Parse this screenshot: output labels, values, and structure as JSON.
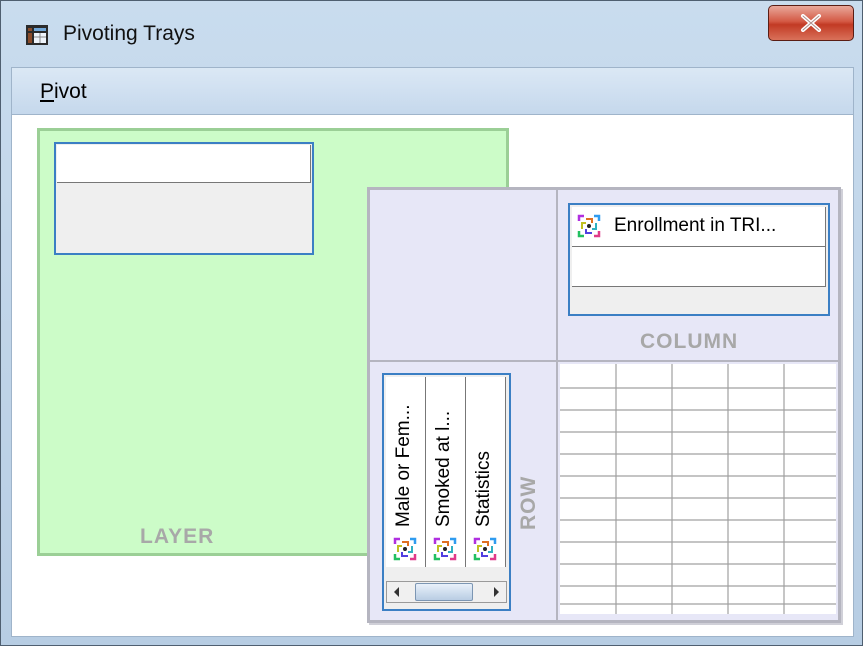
{
  "window": {
    "title": "Pivoting Trays",
    "close_glyph": "x"
  },
  "menu": {
    "pivot_mnemonic": "P",
    "pivot_rest": "ivot"
  },
  "layer": {
    "label": "LAYER"
  },
  "column": {
    "label": "COLUMN",
    "items": [
      {
        "label": "Enrollment in TRI...",
        "icon": "variable-icon"
      }
    ]
  },
  "row": {
    "label": "ROW",
    "items": [
      {
        "label": "Male or Fem...",
        "icon": "variable-icon"
      },
      {
        "label": "Smoked at l...",
        "icon": "variable-icon"
      },
      {
        "label": "Statistics",
        "icon": "variable-icon"
      }
    ]
  },
  "colors": {
    "layer_bg": "#ccfcc8",
    "panel_bg": "#e7e7f7",
    "list_border": "#3b7fc4",
    "close_red": "#c23a24"
  }
}
